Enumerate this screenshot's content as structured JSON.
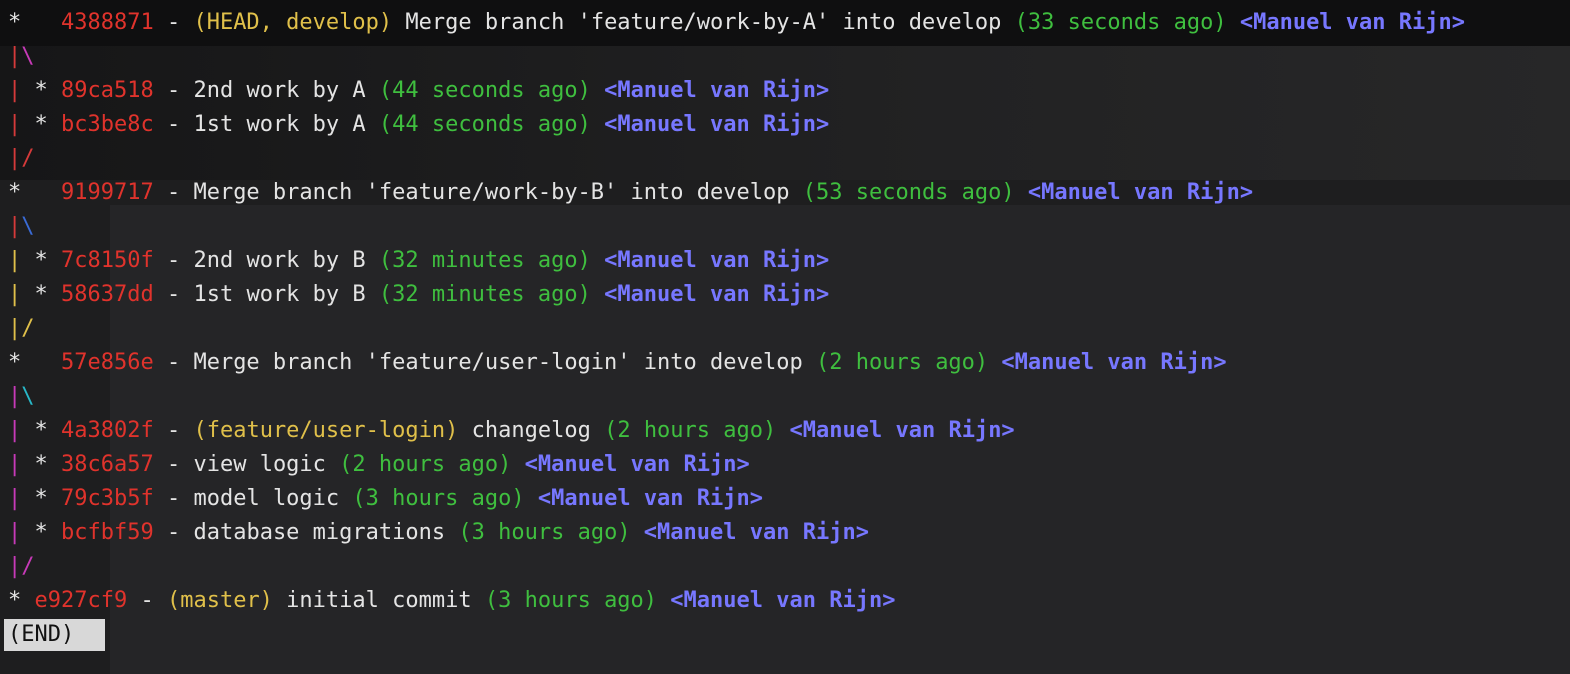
{
  "log": [
    {
      "graph": [
        {
          "t": "*   ",
          "c": "graph"
        }
      ],
      "hash": "4388871",
      "sep": " - ",
      "refs": "(HEAD, develop)",
      "message": " Merge branch 'feature/work-by-A' into develop ",
      "time": "(33 seconds ago)",
      "author": " <Manuel van Rijn>"
    },
    {
      "graph": [
        {
          "t": "|",
          "c": "g-red"
        },
        {
          "t": "\\",
          "c": "g-magenta"
        }
      ],
      "hash": "",
      "sep": "",
      "refs": "",
      "message": "",
      "time": "",
      "author": ""
    },
    {
      "graph": [
        {
          "t": "|",
          "c": "g-red"
        },
        {
          "t": " * ",
          "c": "graph"
        }
      ],
      "hash": "89ca518",
      "sep": " - ",
      "refs": "",
      "message": "2nd work by A ",
      "time": "(44 seconds ago)",
      "author": " <Manuel van Rijn>"
    },
    {
      "graph": [
        {
          "t": "|",
          "c": "g-red"
        },
        {
          "t": " * ",
          "c": "graph"
        }
      ],
      "hash": "bc3be8c",
      "sep": " - ",
      "refs": "",
      "message": "1st work by A ",
      "time": "(44 seconds ago)",
      "author": " <Manuel van Rijn>"
    },
    {
      "graph": [
        {
          "t": "|/",
          "c": "g-red"
        }
      ],
      "hash": "",
      "sep": "",
      "refs": "",
      "message": "",
      "time": "",
      "author": ""
    },
    {
      "graph": [
        {
          "t": "*   ",
          "c": "graph"
        }
      ],
      "hash": "9199717",
      "sep": " - ",
      "refs": "",
      "message": "Merge branch 'feature/work-by-B' into develop ",
      "time": "(53 seconds ago)",
      "author": " <Manuel van Rijn>"
    },
    {
      "graph": [
        {
          "t": "|",
          "c": "g-red"
        },
        {
          "t": "\\",
          "c": "g-blue"
        }
      ],
      "hash": "",
      "sep": "",
      "refs": "",
      "message": "",
      "time": "",
      "author": ""
    },
    {
      "graph": [
        {
          "t": "|",
          "c": "refs"
        },
        {
          "t": " * ",
          "c": "graph"
        }
      ],
      "hash": "7c8150f",
      "sep": " - ",
      "refs": "",
      "message": "2nd work by B ",
      "time": "(32 minutes ago)",
      "author": " <Manuel van Rijn>"
    },
    {
      "graph": [
        {
          "t": "|",
          "c": "refs"
        },
        {
          "t": " * ",
          "c": "graph"
        }
      ],
      "hash": "58637dd",
      "sep": " - ",
      "refs": "",
      "message": "1st work by B ",
      "time": "(32 minutes ago)",
      "author": " <Manuel van Rijn>"
    },
    {
      "graph": [
        {
          "t": "|/",
          "c": "refs"
        }
      ],
      "hash": "",
      "sep": "",
      "refs": "",
      "message": "",
      "time": "",
      "author": ""
    },
    {
      "graph": [
        {
          "t": "*   ",
          "c": "graph"
        }
      ],
      "hash": "57e856e",
      "sep": " - ",
      "refs": "",
      "message": "Merge branch 'feature/user-login' into develop ",
      "time": "(2 hours ago)",
      "author": " <Manuel van Rijn>"
    },
    {
      "graph": [
        {
          "t": "|",
          "c": "g-magenta"
        },
        {
          "t": "\\",
          "c": "g-cyan"
        }
      ],
      "hash": "",
      "sep": "",
      "refs": "",
      "message": "",
      "time": "",
      "author": ""
    },
    {
      "graph": [
        {
          "t": "|",
          "c": "g-magenta"
        },
        {
          "t": " * ",
          "c": "graph"
        }
      ],
      "hash": "4a3802f",
      "sep": " - ",
      "refs": "(feature/user-login)",
      "message": " changelog ",
      "time": "(2 hours ago)",
      "author": " <Manuel van Rijn>"
    },
    {
      "graph": [
        {
          "t": "|",
          "c": "g-magenta"
        },
        {
          "t": " * ",
          "c": "graph"
        }
      ],
      "hash": "38c6a57",
      "sep": " - ",
      "refs": "",
      "message": "view logic ",
      "time": "(2 hours ago)",
      "author": " <Manuel van Rijn>"
    },
    {
      "graph": [
        {
          "t": "|",
          "c": "g-magenta"
        },
        {
          "t": " * ",
          "c": "graph"
        }
      ],
      "hash": "79c3b5f",
      "sep": " - ",
      "refs": "",
      "message": "model logic ",
      "time": "(3 hours ago)",
      "author": " <Manuel van Rijn>"
    },
    {
      "graph": [
        {
          "t": "|",
          "c": "g-magenta"
        },
        {
          "t": " * ",
          "c": "graph"
        }
      ],
      "hash": "bcfbf59",
      "sep": " - ",
      "refs": "",
      "message": "database migrations ",
      "time": "(3 hours ago)",
      "author": " <Manuel van Rijn>"
    },
    {
      "graph": [
        {
          "t": "|/",
          "c": "g-magenta"
        }
      ],
      "hash": "",
      "sep": "",
      "refs": "",
      "message": "",
      "time": "",
      "author": ""
    },
    {
      "graph": [
        {
          "t": "* ",
          "c": "graph"
        }
      ],
      "hash": "e927cf9",
      "sep": " - ",
      "refs": "(master)",
      "message": " initial commit ",
      "time": "(3 hours ago)",
      "author": " <Manuel van Rijn>"
    }
  ],
  "pager": {
    "end_label": "(END)"
  },
  "colors": {
    "hash": "#e0332c",
    "refs": "#e0c04a",
    "time": "#3fbf3f",
    "author": "#7777ff",
    "background": "#1e1e1f"
  }
}
